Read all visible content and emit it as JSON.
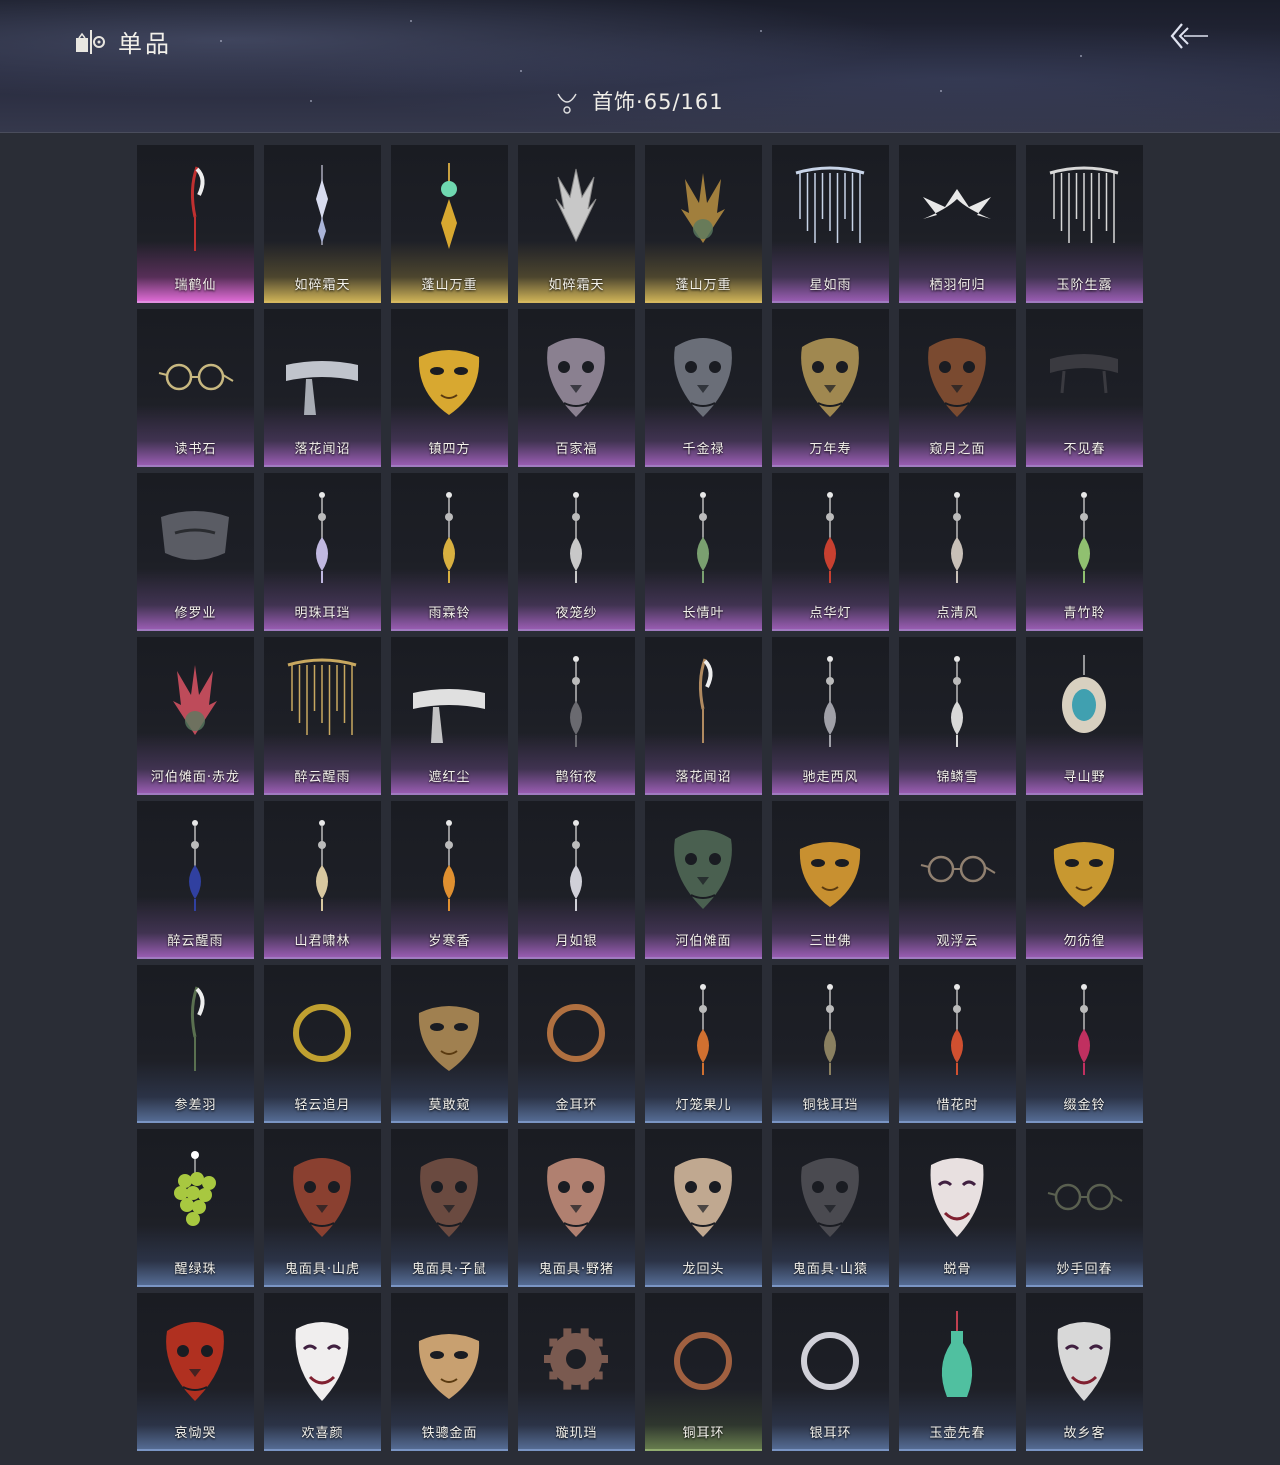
{
  "header": {
    "title": "单品",
    "category_label": "首饰·65/161"
  },
  "icons": {
    "title": "wardrobe-icon",
    "back": "back-arrow-icon",
    "category": "necklace-icon"
  },
  "colors": {
    "purple": "#a07bc0",
    "pink": "#e090e0",
    "gold": "#d6b860",
    "blue": "#7a95c4",
    "green": "#92ad70"
  },
  "items": [
    {
      "name": "瑞鹤仙",
      "rarity": "pink",
      "art": "feather-pin",
      "c": "#c03030"
    },
    {
      "name": "如碎霜天",
      "rarity": "gold",
      "art": "crystal-pin",
      "c": "#d8dcef"
    },
    {
      "name": "蓬山万重",
      "rarity": "gold",
      "art": "jade-pin",
      "c": "#6fd8b0"
    },
    {
      "name": "如碎霜天",
      "rarity": "gold",
      "art": "spiky-crown",
      "c": "#c8c8c8"
    },
    {
      "name": "蓬山万重",
      "rarity": "gold",
      "art": "leaf-crown",
      "c": "#b08a40"
    },
    {
      "name": "星如雨",
      "rarity": "purple",
      "art": "veil",
      "c": "#c8d4e8"
    },
    {
      "name": "栖羽何归",
      "rarity": "purple",
      "art": "wings",
      "c": "#e8e8e8"
    },
    {
      "name": "玉阶生露",
      "rarity": "purple",
      "art": "veil",
      "c": "#d8d8d8"
    },
    {
      "name": "读书石",
      "rarity": "purple",
      "art": "glasses",
      "c": "#c8b880"
    },
    {
      "name": "落花闻诏",
      "rarity": "purple",
      "art": "blindfold",
      "c": "#c0c4cc"
    },
    {
      "name": "镇四方",
      "rarity": "purple",
      "art": "gold-mask",
      "c": "#d8a830"
    },
    {
      "name": "百家福",
      "rarity": "purple",
      "art": "animal-mask",
      "c": "#8a8090"
    },
    {
      "name": "千金禄",
      "rarity": "purple",
      "art": "animal-mask",
      "c": "#6a6e78"
    },
    {
      "name": "万年寿",
      "rarity": "purple",
      "art": "animal-mask",
      "c": "#a08850"
    },
    {
      "name": "窥月之面",
      "rarity": "purple",
      "art": "animal-mask",
      "c": "#7a4a30"
    },
    {
      "name": "不见春",
      "rarity": "purple",
      "art": "band",
      "c": "#3a3a40"
    },
    {
      "name": "修罗业",
      "rarity": "purple",
      "art": "half-mask",
      "c": "#5a5c64"
    },
    {
      "name": "明珠耳珰",
      "rarity": "purple",
      "art": "earring",
      "c": "#c0b8e0"
    },
    {
      "name": "雨霖铃",
      "rarity": "purple",
      "art": "earring",
      "c": "#d8b040"
    },
    {
      "name": "夜笼纱",
      "rarity": "purple",
      "art": "earring",
      "c": "#c8c8c8"
    },
    {
      "name": "长情叶",
      "rarity": "purple",
      "art": "earring",
      "c": "#7aa070"
    },
    {
      "name": "点华灯",
      "rarity": "purple",
      "art": "earring",
      "c": "#c84030"
    },
    {
      "name": "点清风",
      "rarity": "purple",
      "art": "earring",
      "c": "#c8c0b8"
    },
    {
      "name": "青竹聆",
      "rarity": "purple",
      "art": "earring",
      "c": "#90c070"
    },
    {
      "name": "河伯傩面·赤龙",
      "rarity": "purple",
      "art": "leaf-crown",
      "c": "#d05060"
    },
    {
      "name": "醉云醒雨",
      "rarity": "purple",
      "art": "veil",
      "c": "#c8a860"
    },
    {
      "name": "遮红尘",
      "rarity": "purple",
      "art": "blindfold",
      "c": "#e0e0e0"
    },
    {
      "name": "鹊衔夜",
      "rarity": "purple",
      "art": "earring",
      "c": "#6a6a70"
    },
    {
      "name": "落花闻诏",
      "rarity": "purple",
      "art": "feather-pin",
      "c": "#b08a60"
    },
    {
      "name": "驰走西风",
      "rarity": "purple",
      "art": "earring",
      "c": "#a0a0a8"
    },
    {
      "name": "锦鳞雪",
      "rarity": "purple",
      "art": "earring",
      "c": "#d8d8d8"
    },
    {
      "name": "寻山野",
      "rarity": "purple",
      "art": "pendant",
      "c": "#40a0b0"
    },
    {
      "name": "醉云醒雨",
      "rarity": "purple",
      "art": "earring",
      "c": "#3040a0"
    },
    {
      "name": "山君啸林",
      "rarity": "purple",
      "art": "earring",
      "c": "#d8c8a0"
    },
    {
      "name": "岁寒香",
      "rarity": "purple",
      "art": "earring",
      "c": "#e09030"
    },
    {
      "name": "月如银",
      "rarity": "purple",
      "art": "earring",
      "c": "#d0d0d8"
    },
    {
      "name": "河伯傩面",
      "rarity": "purple",
      "art": "animal-mask",
      "c": "#4a6050"
    },
    {
      "name": "三世佛",
      "rarity": "purple",
      "art": "gold-mask",
      "c": "#c89030"
    },
    {
      "name": "观浮云",
      "rarity": "purple",
      "art": "glasses",
      "c": "#908070"
    },
    {
      "name": "勿彷徨",
      "rarity": "purple",
      "art": "gold-mask",
      "c": "#c89830"
    },
    {
      "name": "参差羽",
      "rarity": "blue",
      "art": "feather-pin",
      "c": "#5a7050"
    },
    {
      "name": "轻云追月",
      "rarity": "blue",
      "art": "ring",
      "c": "#c0a030"
    },
    {
      "name": "莫敢窥",
      "rarity": "blue",
      "art": "gold-mask",
      "c": "#a08050"
    },
    {
      "name": "金耳环",
      "rarity": "blue",
      "art": "ring",
      "c": "#b07040"
    },
    {
      "name": "灯笼果儿",
      "rarity": "blue",
      "art": "earring",
      "c": "#d07030"
    },
    {
      "name": "铜钱耳珰",
      "rarity": "blue",
      "art": "earring",
      "c": "#8a8060"
    },
    {
      "name": "惜花时",
      "rarity": "blue",
      "art": "earring",
      "c": "#d05030"
    },
    {
      "name": "缀金铃",
      "rarity": "blue",
      "art": "earring",
      "c": "#c03060"
    },
    {
      "name": "醒绿珠",
      "rarity": "blue",
      "art": "grapes",
      "c": "#a8c840"
    },
    {
      "name": "鬼面具·山虎",
      "rarity": "blue",
      "art": "animal-mask",
      "c": "#8a4030"
    },
    {
      "name": "鬼面具·子鼠",
      "rarity": "blue",
      "art": "animal-mask",
      "c": "#6a4a40"
    },
    {
      "name": "鬼面具·野猪",
      "rarity": "blue",
      "art": "animal-mask",
      "c": "#b08070"
    },
    {
      "name": "龙回头",
      "rarity": "blue",
      "art": "animal-mask",
      "c": "#c0a890"
    },
    {
      "name": "鬼面具·山猿",
      "rarity": "blue",
      "art": "animal-mask",
      "c": "#4a4a50"
    },
    {
      "name": "蜕骨",
      "rarity": "blue",
      "art": "white-mask",
      "c": "#e8e0e0"
    },
    {
      "name": "妙手回春",
      "rarity": "blue",
      "art": "glasses",
      "c": "#5a6050"
    },
    {
      "name": "哀恸哭",
      "rarity": "blue",
      "art": "animal-mask",
      "c": "#b03020"
    },
    {
      "name": "欢喜颜",
      "rarity": "blue",
      "art": "white-mask",
      "c": "#f0eeee"
    },
    {
      "name": "铁骢金面",
      "rarity": "blue",
      "art": "gold-mask",
      "c": "#c8a070"
    },
    {
      "name": "璇玑珰",
      "rarity": "blue",
      "art": "gear",
      "c": "#7a5a50"
    },
    {
      "name": "铜耳环",
      "rarity": "green",
      "art": "ring",
      "c": "#a06040"
    },
    {
      "name": "银耳环",
      "rarity": "blue",
      "art": "ring",
      "c": "#d0d0d8"
    },
    {
      "name": "玉壶先春",
      "rarity": "blue",
      "art": "vase",
      "c": "#50c0a0"
    },
    {
      "name": "故乡客",
      "rarity": "blue",
      "art": "white-mask",
      "c": "#d8d8d8"
    }
  ]
}
